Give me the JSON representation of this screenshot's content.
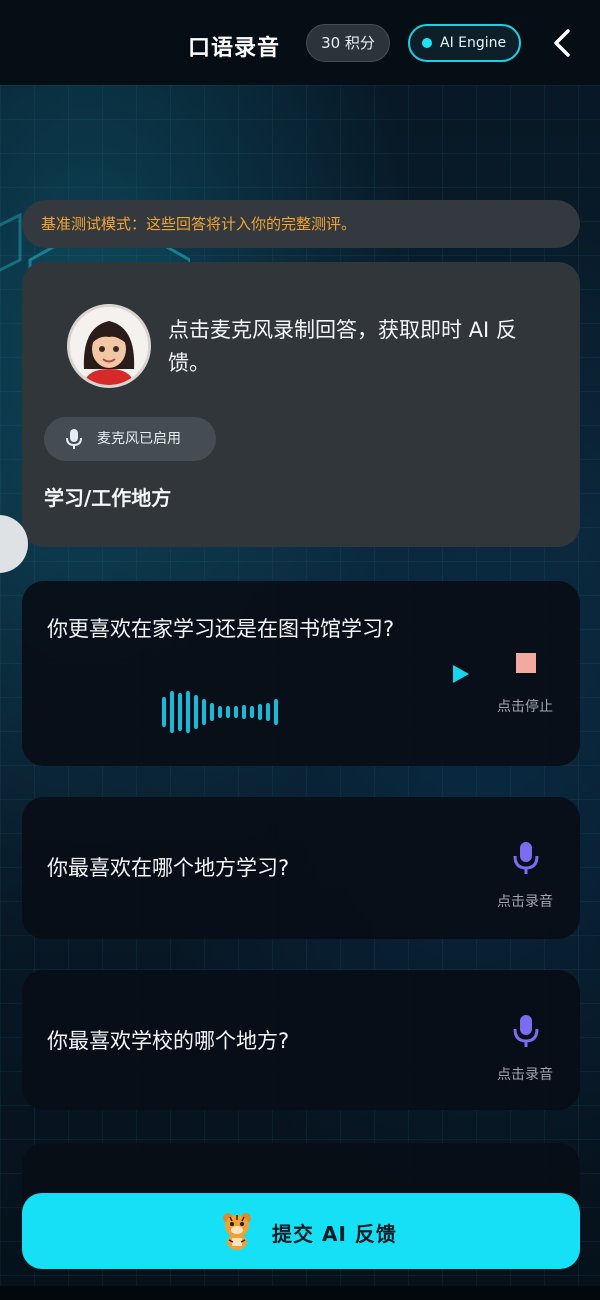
{
  "header": {
    "title": "口语录音",
    "points_label": "30 积分",
    "engine_label": "AI Engine"
  },
  "banner": {
    "text": "基准测试模式：这些回答将计入你的完整测评。"
  },
  "intro": {
    "text": "点击麦克风录制回答，获取即时 AI 反馈。",
    "mic_status": "麦克风已启用",
    "topic": "学习/工作地方"
  },
  "questions": [
    {
      "text": "你更喜欢在家学习还是在图书馆学习?",
      "action_label": "点击停止",
      "state": "recording"
    },
    {
      "text": "你最喜欢在哪个地方学习?",
      "action_label": "点击录音",
      "state": "idle"
    },
    {
      "text": "你最喜欢学校的哪个地方?",
      "action_label": "点击录音",
      "state": "idle"
    }
  ],
  "submit": {
    "label": "提交 AI 反馈"
  },
  "colors": {
    "accent": "#15e0f5",
    "warning": "#f2a532",
    "mic": "#7b6cf0",
    "stop": "#f3a9a0"
  },
  "icons": [
    "back-chevron-icon",
    "microphone-icon",
    "play-icon",
    "stop-icon",
    "tiger-mascot-icon"
  ]
}
